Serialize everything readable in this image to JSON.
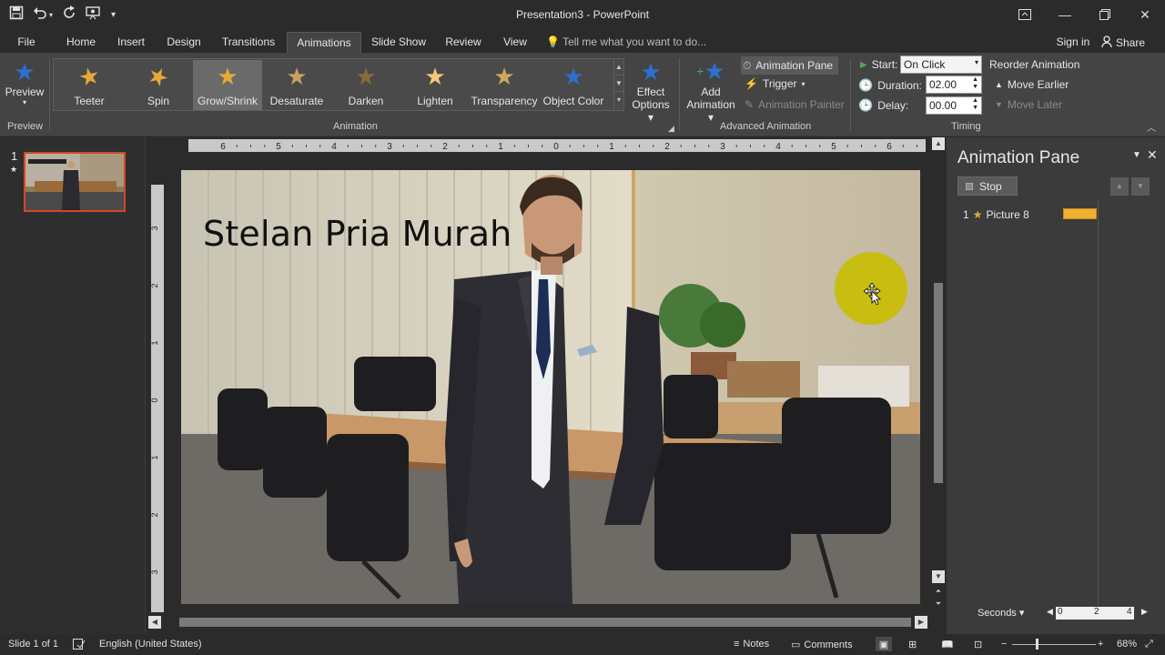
{
  "app": {
    "window_title": "Presentation3 - PowerPoint",
    "sign_in": "Sign in",
    "share": "Share",
    "colors": {
      "accent": "#d24726",
      "star_gold": "#e8a838",
      "star_blue": "#2e6fd1",
      "hotspot": "#c8be00"
    }
  },
  "quick_access": {
    "save_icon": "save-icon",
    "undo_icon": "undo-icon",
    "redo_icon": "redo-icon",
    "start_from_beginning_icon": "present-icon",
    "customize_icon": "customize-icon"
  },
  "tabs": [
    {
      "label": "File"
    },
    {
      "label": "Home"
    },
    {
      "label": "Insert"
    },
    {
      "label": "Design"
    },
    {
      "label": "Transitions"
    },
    {
      "label": "Animations",
      "active": true
    },
    {
      "label": "Slide Show"
    },
    {
      "label": "Review"
    },
    {
      "label": "View"
    }
  ],
  "tell_me": "Tell me what you want to do...",
  "ribbon": {
    "preview": {
      "label": "Preview",
      "group": "Preview"
    },
    "animation_group": "Animation",
    "gallery": [
      {
        "label": "Teeter"
      },
      {
        "label": "Spin"
      },
      {
        "label": "Grow/Shrink",
        "selected": true
      },
      {
        "label": "Desaturate"
      },
      {
        "label": "Darken"
      },
      {
        "label": "Lighten"
      },
      {
        "label": "Transparency"
      },
      {
        "label": "Object Color"
      }
    ],
    "effect_options": {
      "line1": "Effect",
      "line2": "Options"
    },
    "advanced": {
      "group": "Advanced Animation",
      "add_animation_line1": "Add",
      "add_animation_line2": "Animation",
      "animation_pane": "Animation Pane",
      "trigger": "Trigger",
      "animation_painter": "Animation Painter"
    },
    "timing": {
      "group": "Timing",
      "start_label": "Start:",
      "start_value": "On Click",
      "duration_label": "Duration:",
      "duration_value": "02.00",
      "delay_label": "Delay:",
      "delay_value": "00.00",
      "reorder": "Reorder Animation",
      "move_earlier": "Move Earlier",
      "move_later": "Move Later"
    }
  },
  "thumbnails": [
    {
      "number": "1",
      "star": "★"
    }
  ],
  "rulers": {
    "h_ticks": [
      "6",
      "5",
      "4",
      "3",
      "2",
      "1",
      "0",
      "1",
      "2",
      "3",
      "4",
      "5",
      "6"
    ],
    "v_ticks": [
      "3",
      "2",
      "1",
      "0",
      "1",
      "2",
      "3"
    ]
  },
  "slide": {
    "title": "Stelan Pria Murah"
  },
  "animation_pane": {
    "title": "Animation Pane",
    "stop_button": "Stop",
    "items": [
      {
        "number": "1",
        "name": "Picture 8"
      }
    ],
    "timeline_unit": "Seconds",
    "timeline_ticks": [
      "0",
      "2",
      "4"
    ]
  },
  "status": {
    "slide_info": "Slide 1 of 1",
    "language": "English (United States)",
    "notes": "Notes",
    "comments": "Comments",
    "zoom": "68%"
  }
}
